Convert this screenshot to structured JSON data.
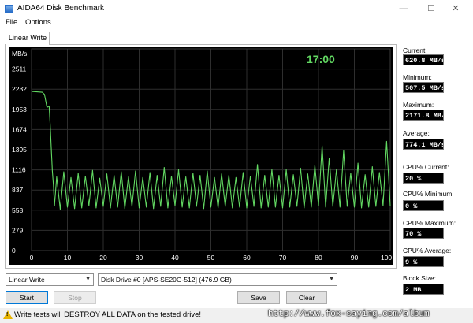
{
  "window": {
    "title": "AIDA64 Disk Benchmark",
    "minimize_glyph": "—",
    "maximize_glyph": "☐",
    "close_glyph": "✕"
  },
  "menu": {
    "file": "File",
    "options": "Options"
  },
  "tab": {
    "active": "Linear Write"
  },
  "chart_data": {
    "type": "line",
    "elapsed_time": "17:00",
    "unit_label": "MB/s",
    "y_ticks": [
      "2511",
      "2232",
      "1953",
      "1674",
      "1395",
      "1116",
      "837",
      "558",
      "279",
      "0"
    ],
    "y_tick_values": [
      2511,
      2232,
      2232,
      1953,
      1674,
      1395,
      1116,
      837,
      558,
      279,
      0
    ],
    "x_ticks": [
      "0",
      "10",
      "20",
      "30",
      "40",
      "50",
      "60",
      "70",
      "80",
      "90",
      "100 %"
    ],
    "ylim": [
      0,
      2790
    ],
    "xlim": [
      0,
      100
    ],
    "grid": true,
    "line_color": "#62d862",
    "series": [
      {
        "x": [
          0,
          3,
          3.6,
          4.3,
          4.9,
          5.2,
          5.5,
          5.8,
          6.1,
          6.4,
          7,
          8,
          9,
          10,
          11,
          12,
          13,
          14,
          15,
          16,
          17,
          18,
          19,
          20,
          21,
          22,
          23,
          24,
          25,
          26,
          27,
          28,
          29,
          30,
          31,
          32,
          33,
          34,
          35,
          36,
          37,
          38,
          39,
          40,
          41,
          42,
          43,
          44,
          45,
          46,
          47,
          48,
          49,
          50,
          51,
          52,
          53,
          54,
          55,
          56,
          57,
          58,
          59,
          60,
          61,
          62,
          63,
          64,
          65,
          66,
          67,
          68,
          69,
          70,
          71,
          72,
          73,
          74,
          75,
          76,
          77,
          78,
          79,
          80,
          81,
          82,
          83,
          84,
          85,
          86,
          87,
          88,
          89,
          90,
          91,
          92,
          93,
          94,
          95,
          96,
          97,
          98,
          99,
          100
        ],
        "values": [
          2200,
          2190,
          2160,
          1980,
          2000,
          1730,
          1420,
          1100,
          900,
          620,
          1020,
          570,
          1090,
          600,
          1010,
          580,
          1070,
          590,
          1030,
          620,
          1110,
          590,
          1000,
          610,
          1060,
          590,
          1040,
          600,
          1090,
          580,
          1020,
          610,
          1100,
          590,
          1010,
          600,
          1080,
          580,
          1040,
          610,
          1150,
          590,
          1030,
          620,
          1120,
          600,
          1020,
          590,
          1070,
          610,
          1040,
          580,
          1100,
          600,
          1010,
          590,
          1060,
          610,
          1040,
          590,
          1010,
          600,
          1080,
          590,
          1030,
          610,
          1190,
          590,
          1040,
          600,
          1120,
          600,
          1040,
          590,
          1120,
          600,
          1050,
          610,
          1140,
          590,
          1060,
          600,
          1180,
          620,
          1450,
          600,
          1280,
          610,
          1120,
          600,
          1380,
          610,
          1070,
          600,
          1210,
          590,
          1050,
          600,
          1160,
          610,
          1080,
          620,
          1510,
          620
        ]
      }
    ]
  },
  "stats": {
    "current_label": "Current:",
    "current_value": "620.8 MB/s",
    "minimum_label": "Minimum:",
    "minimum_value": "507.5 MB/s",
    "maximum_label": "Maximum:",
    "maximum_value": "2171.8 MB/s",
    "average_label": "Average:",
    "average_value": "774.1 MB/s",
    "cpu_current_label": "CPU% Current:",
    "cpu_current_value": "20 %",
    "cpu_minimum_label": "CPU% Minimum:",
    "cpu_minimum_value": "0 %",
    "cpu_maximum_label": "CPU% Maximum:",
    "cpu_maximum_value": "70 %",
    "cpu_average_label": "CPU% Average:",
    "cpu_average_value": "9 %",
    "block_size_label": "Block Size:",
    "block_size_value": "2 MB"
  },
  "controls": {
    "test_mode": "Linear Write",
    "drive": "Disk Drive #0  [APS-SE20G-512]  (476.9 GB)",
    "start": "Start",
    "stop": "Stop",
    "save": "Save",
    "clear": "Clear"
  },
  "status": {
    "warning": "Write tests will DESTROY ALL DATA on the tested drive!"
  },
  "watermark": "http://www.fox-saying.com/album"
}
